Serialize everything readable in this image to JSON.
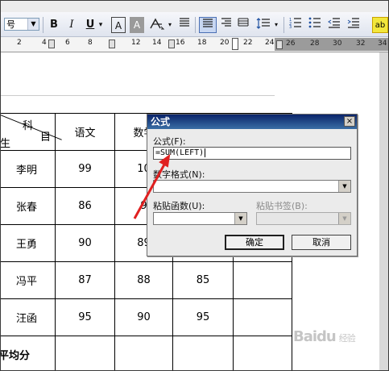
{
  "toolbar": {
    "font_size_value": "号",
    "buttons": [
      "B",
      "I",
      "U",
      "A",
      "A"
    ],
    "underline_arrow": "▾",
    "highlight_label": "ab"
  },
  "ruler": {
    "ticks": [
      "2",
      "4",
      "6",
      "8",
      "12",
      "14",
      "16",
      "18",
      "20",
      "22",
      "24",
      "26",
      "28",
      "30",
      "32",
      "34"
    ]
  },
  "table": {
    "header": {
      "corner_top": "科",
      "corner_right": "目",
      "corner_left": "生",
      "col1": "语文",
      "col2": "数学"
    },
    "rows": [
      {
        "name": "李明",
        "v1": "99",
        "v2": "10"
      },
      {
        "name": "张春",
        "v1": "86",
        "v2": "9"
      },
      {
        "name": "王勇",
        "v1": "90",
        "v2": "89"
      },
      {
        "name": "冯平",
        "v1": "87",
        "v2": "88",
        "v3": "85"
      },
      {
        "name": "汪函",
        "v1": "95",
        "v2": "90",
        "v3": "95"
      }
    ],
    "footer": "平均分"
  },
  "dialog": {
    "title": "公式",
    "close": "×",
    "formula_label": "公式(F):",
    "formula_value": "=SUM(LEFT)",
    "number_format_label": "数字格式(N):",
    "paste_function_label": "粘贴函数(U):",
    "paste_bookmark_label": "粘贴书签(B):",
    "ok": "确定",
    "cancel": "取消"
  },
  "watermark": {
    "text": "Baidu",
    "sub": "经验"
  },
  "colors": {
    "title_bar": "#0a246a",
    "arrow": "#e02020"
  }
}
